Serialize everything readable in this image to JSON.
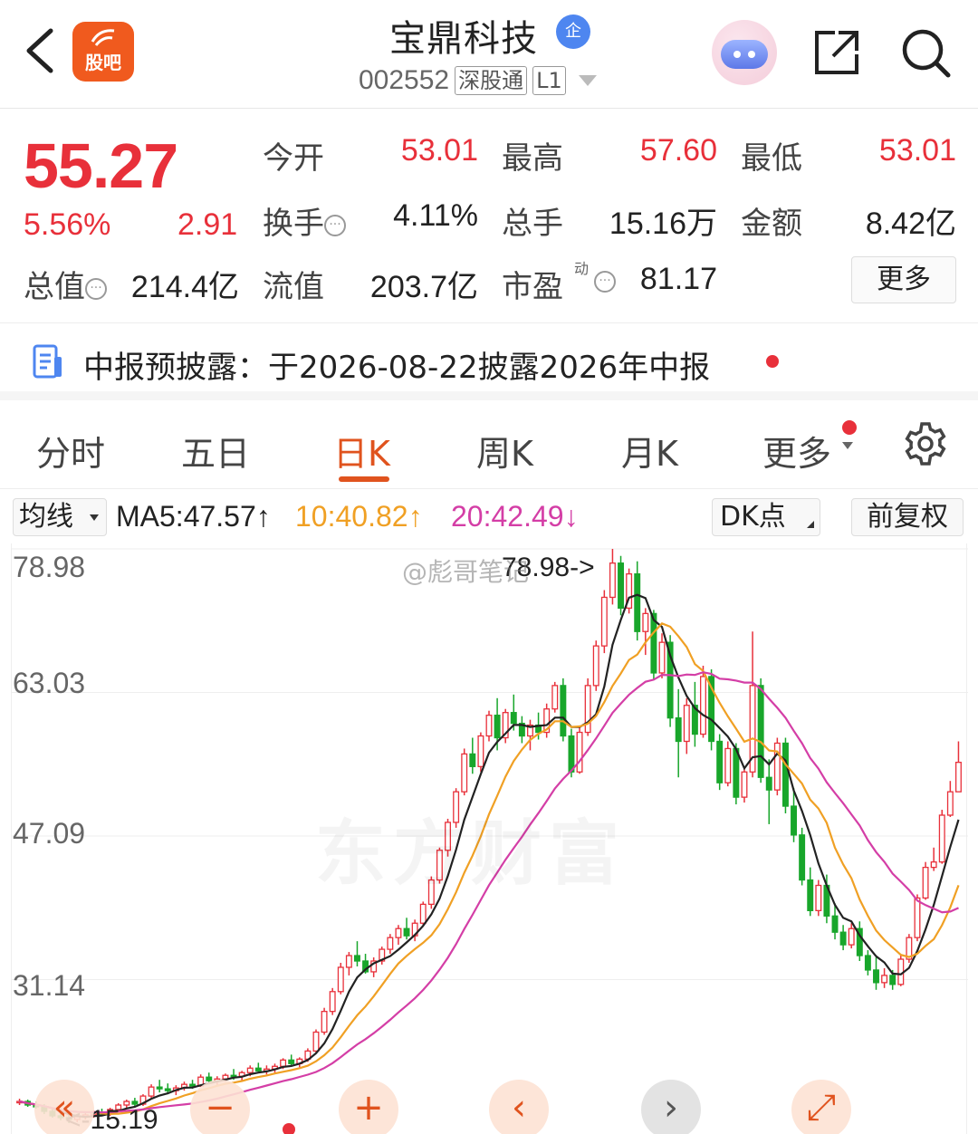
{
  "header": {
    "stock_name": "宝鼎科技",
    "qi_badge": "企",
    "stock_code": "002552",
    "tags": [
      "深股通",
      "L1"
    ],
    "guba_label": "股吧"
  },
  "quote": {
    "price": "55.27",
    "change_pct": "5.56%",
    "change_abs": "2.91",
    "open_label": "今开",
    "open_value": "53.01",
    "high_label": "最高",
    "high_value": "57.60",
    "low_label": "最低",
    "low_value": "53.01",
    "turnover_label": "换手",
    "turnover_value": "4.11%",
    "volume_label": "总手",
    "volume_value": "15.16万",
    "amount_label": "金额",
    "amount_value": "8.42亿",
    "total_mv_label": "总值",
    "total_mv_value": "214.4亿",
    "float_mv_label": "流值",
    "float_mv_value": "203.7亿",
    "pe_label": "市盈",
    "pe_sup": "动",
    "pe_value": "81.17",
    "more_label": "更多"
  },
  "disclosure": {
    "text": "中报预披露：于2026-08-22披露2026年中报"
  },
  "tabs": {
    "items": [
      "分时",
      "五日",
      "日K",
      "周K",
      "月K",
      "更多"
    ],
    "active": "日K"
  },
  "ma": {
    "selector_label": "均线",
    "ma5": "MA5:47.57↑",
    "ma10": "10:40.82↑",
    "ma20": "20:42.49↓",
    "dk_label": "DK点",
    "adjust_label": "前复权"
  },
  "chart_data": {
    "type": "candlestick",
    "y_ticks": [
      "78.98",
      "63.03",
      "47.09",
      "31.14"
    ],
    "high_marker": "78.98->",
    "low_marker": "<-15.19",
    "watermark": "东方财富",
    "weibo_watermark": "@彪哥笔记",
    "colors": {
      "up": "#e8303a",
      "down": "#18a62b",
      "ma5": "#222222",
      "ma10": "#f0a024",
      "ma20": "#d43ea6"
    },
    "ylim": [
      15.19,
      78.98
    ],
    "candles": [
      [
        17.5,
        17.9,
        17.2,
        17.6
      ],
      [
        17.6,
        17.8,
        17.0,
        17.2
      ],
      [
        17.2,
        17.6,
        16.8,
        17.0
      ],
      [
        17.0,
        17.3,
        16.2,
        16.5
      ],
      [
        16.5,
        16.9,
        15.8,
        16.0
      ],
      [
        16.0,
        16.4,
        15.5,
        15.8
      ],
      [
        15.8,
        16.2,
        15.19,
        15.6
      ],
      [
        15.6,
        16.0,
        15.3,
        15.9
      ],
      [
        15.9,
        16.3,
        15.6,
        16.1
      ],
      [
        16.1,
        16.6,
        15.8,
        16.4
      ],
      [
        16.4,
        16.8,
        16.0,
        16.2
      ],
      [
        16.2,
        16.9,
        16.0,
        16.7
      ],
      [
        16.7,
        17.4,
        16.5,
        17.2
      ],
      [
        17.2,
        17.8,
        16.9,
        17.6
      ],
      [
        17.6,
        18.0,
        17.0,
        17.3
      ],
      [
        17.3,
        18.4,
        17.1,
        18.2
      ],
      [
        18.2,
        19.5,
        18.0,
        19.2
      ],
      [
        19.2,
        20.0,
        18.6,
        19.0
      ],
      [
        19.0,
        19.6,
        18.4,
        18.8
      ],
      [
        18.8,
        19.4,
        18.3,
        19.1
      ],
      [
        19.1,
        19.8,
        18.8,
        19.5
      ],
      [
        19.5,
        20.0,
        19.0,
        19.3
      ],
      [
        19.3,
        20.6,
        19.2,
        20.3
      ],
      [
        20.3,
        20.8,
        19.6,
        19.9
      ],
      [
        19.9,
        20.4,
        19.4,
        20.1
      ],
      [
        20.1,
        20.7,
        19.8,
        20.5
      ],
      [
        20.5,
        21.2,
        20.0,
        20.4
      ],
      [
        20.4,
        21.0,
        19.9,
        20.8
      ],
      [
        20.8,
        21.6,
        20.4,
        21.3
      ],
      [
        21.3,
        21.9,
        20.9,
        21.0
      ],
      [
        21.0,
        21.6,
        20.6,
        21.2
      ],
      [
        21.2,
        21.8,
        20.8,
        21.5
      ],
      [
        21.5,
        22.4,
        21.2,
        22.2
      ],
      [
        22.2,
        22.8,
        21.5,
        21.8
      ],
      [
        21.8,
        22.5,
        21.4,
        22.3
      ],
      [
        22.3,
        23.5,
        22.0,
        23.2
      ],
      [
        23.2,
        25.6,
        23.0,
        25.3
      ],
      [
        25.3,
        28.0,
        25.0,
        27.6
      ],
      [
        27.6,
        30.2,
        27.2,
        29.8
      ],
      [
        29.8,
        33.0,
        29.5,
        32.5
      ],
      [
        32.5,
        34.2,
        31.6,
        33.8
      ],
      [
        33.8,
        35.4,
        32.6,
        33.2
      ],
      [
        33.2,
        34.0,
        31.8,
        32.0
      ],
      [
        32.0,
        33.6,
        31.4,
        33.2
      ],
      [
        33.2,
        34.8,
        32.8,
        34.5
      ],
      [
        34.5,
        36.2,
        34.0,
        35.8
      ],
      [
        35.8,
        37.2,
        35.0,
        36.8
      ],
      [
        36.8,
        38.0,
        35.6,
        36.0
      ],
      [
        36.0,
        37.8,
        35.4,
        37.4
      ],
      [
        37.4,
        39.8,
        37.0,
        39.5
      ],
      [
        39.5,
        42.6,
        39.0,
        42.2
      ],
      [
        42.2,
        45.8,
        41.8,
        45.5
      ],
      [
        45.5,
        49.0,
        44.8,
        48.6
      ],
      [
        48.6,
        52.4,
        48.0,
        52.0
      ],
      [
        52.0,
        56.8,
        51.6,
        56.2
      ],
      [
        56.2,
        58.0,
        54.0,
        54.8
      ],
      [
        54.8,
        58.6,
        54.2,
        58.2
      ],
      [
        58.2,
        61.0,
        57.6,
        60.5
      ],
      [
        60.5,
        62.4,
        56.6,
        58.0
      ],
      [
        58.0,
        61.2,
        57.4,
        60.8
      ],
      [
        60.8,
        62.8,
        58.8,
        59.6
      ],
      [
        59.6,
        60.4,
        57.4,
        58.2
      ],
      [
        58.2,
        60.0,
        56.6,
        59.4
      ],
      [
        59.4,
        60.8,
        57.8,
        58.6
      ],
      [
        58.6,
        61.8,
        58.0,
        61.2
      ],
      [
        61.2,
        64.2,
        60.8,
        63.8
      ],
      [
        63.8,
        64.6,
        57.6,
        58.2
      ],
      [
        58.2,
        59.0,
        53.6,
        54.2
      ],
      [
        54.2,
        59.2,
        54.0,
        58.6
      ],
      [
        58.6,
        64.6,
        58.2,
        63.8
      ],
      [
        63.8,
        68.8,
        63.2,
        68.2
      ],
      [
        68.2,
        74.4,
        67.4,
        73.6
      ],
      [
        73.6,
        78.98,
        72.8,
        77.4
      ],
      [
        77.4,
        78.2,
        71.6,
        72.4
      ],
      [
        72.4,
        76.8,
        71.8,
        76.2
      ],
      [
        76.2,
        77.6,
        68.8,
        69.8
      ],
      [
        69.8,
        72.4,
        67.2,
        71.8
      ],
      [
        71.8,
        72.2,
        64.4,
        65.2
      ],
      [
        65.2,
        69.6,
        64.6,
        68.6
      ],
      [
        68.6,
        69.4,
        59.2,
        60.2
      ],
      [
        60.2,
        63.4,
        53.6,
        57.6
      ],
      [
        57.6,
        62.4,
        56.2,
        61.6
      ],
      [
        61.6,
        64.2,
        57.0,
        58.4
      ],
      [
        58.4,
        66.0,
        58.0,
        64.8
      ],
      [
        64.8,
        65.6,
        56.6,
        57.6
      ],
      [
        57.6,
        58.4,
        52.2,
        53.0
      ],
      [
        53.0,
        57.6,
        52.6,
        56.8
      ],
      [
        56.8,
        57.4,
        50.6,
        51.4
      ],
      [
        51.4,
        54.8,
        50.8,
        54.2
      ],
      [
        54.2,
        69.8,
        53.6,
        63.8
      ],
      [
        63.8,
        64.6,
        53.0,
        53.6
      ],
      [
        53.6,
        55.6,
        48.4,
        52.2
      ],
      [
        52.2,
        58.0,
        51.6,
        57.4
      ],
      [
        57.4,
        58.0,
        49.6,
        50.4
      ],
      [
        50.4,
        52.4,
        46.4,
        47.2
      ],
      [
        47.2,
        48.0,
        41.6,
        42.2
      ],
      [
        42.2,
        43.6,
        38.2,
        38.8
      ],
      [
        38.8,
        42.2,
        38.2,
        41.6
      ],
      [
        41.6,
        42.8,
        37.4,
        38.2
      ],
      [
        38.2,
        39.6,
        35.6,
        36.4
      ],
      [
        36.4,
        37.2,
        34.4,
        35.0
      ],
      [
        35.0,
        37.4,
        34.6,
        36.8
      ],
      [
        36.8,
        37.6,
        33.2,
        33.8
      ],
      [
        33.8,
        34.4,
        31.6,
        32.2
      ],
      [
        32.2,
        33.6,
        30.0,
        30.8
      ],
      [
        30.8,
        32.4,
        30.2,
        31.6
      ],
      [
        31.6,
        32.2,
        30.0,
        30.6
      ],
      [
        30.6,
        33.8,
        30.4,
        33.4
      ],
      [
        33.4,
        36.2,
        33.0,
        35.8
      ],
      [
        35.8,
        40.6,
        35.4,
        40.2
      ],
      [
        40.2,
        44.2,
        40.0,
        43.6
      ],
      [
        43.6,
        45.8,
        43.2,
        44.2
      ],
      [
        44.2,
        50.0,
        44.0,
        49.4
      ],
      [
        49.4,
        53.2,
        49.2,
        52.0
      ],
      [
        52.0,
        57.6,
        52.0,
        55.27
      ]
    ]
  }
}
